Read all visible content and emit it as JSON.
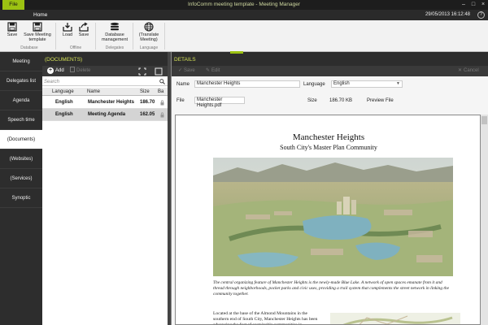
{
  "titlebar": {
    "file_tab": "File",
    "title": "InfoComm meeting template - Meeting Manager"
  },
  "menubar": {
    "home_tab": "Home",
    "datetime": "29/05/2013 16:12:48"
  },
  "ribbon": {
    "buttons": {
      "save": "Save",
      "save_template": "Save Meeting template",
      "load": "Load",
      "save2": "Save",
      "db_mgmt": "Database management",
      "translate": "(Translate Meeting)"
    },
    "groups": {
      "database": "Database",
      "offline": "Offline",
      "delegates": "Delegates",
      "language": "Language"
    }
  },
  "nav": {
    "items": [
      {
        "label": "Meeting"
      },
      {
        "label": "Delegates list"
      },
      {
        "label": "Agenda"
      },
      {
        "label": "Speech time"
      },
      {
        "label": "(Documents)"
      },
      {
        "label": "(Websites)"
      },
      {
        "label": "(Services)"
      },
      {
        "label": "Synoptic"
      }
    ]
  },
  "documents": {
    "header": "(DOCUMENTS)",
    "add_label": "Add",
    "delete_label": "Delete",
    "search_placeholder": "Search",
    "columns": [
      "Language",
      "Name",
      "Size",
      "Ba"
    ],
    "rows": [
      {
        "language": "English",
        "name": "Manchester Heights",
        "size": "186.70"
      },
      {
        "language": "English",
        "name": "Meeting Agenda",
        "size": "162.05"
      }
    ]
  },
  "details": {
    "header": "DETAILS",
    "save_label": "Save",
    "edit_label": "Edit",
    "cancel_label": "Cancel",
    "name_label": "Name",
    "name_value": "Manchester Heights",
    "language_label": "Language",
    "language_value": "English",
    "file_label": "File",
    "file_value": "Manchester Heights.pdf",
    "size_label": "Size",
    "size_value": "186.70 KB",
    "preview_label": "Preview File"
  },
  "preview": {
    "title": "Manchester Heights",
    "subtitle": "South City's Master Plan Community",
    "caption": "The central organizing feature of Manchester Heights is the newly-made Blue Lake. A network of open spaces emanate from it and thread through neighborhoods, pocket parks and civic uses, providing a trail system that complements the street network in linking the community together.",
    "body": "Located at the base of the Almond Mountains in the southern end of South City, Manchester Heights has been advancing the fact of sustainable communities in"
  },
  "colors": {
    "accent": "#9cc212",
    "dark": "#2d2d2d",
    "header_text": "#d4e157"
  }
}
